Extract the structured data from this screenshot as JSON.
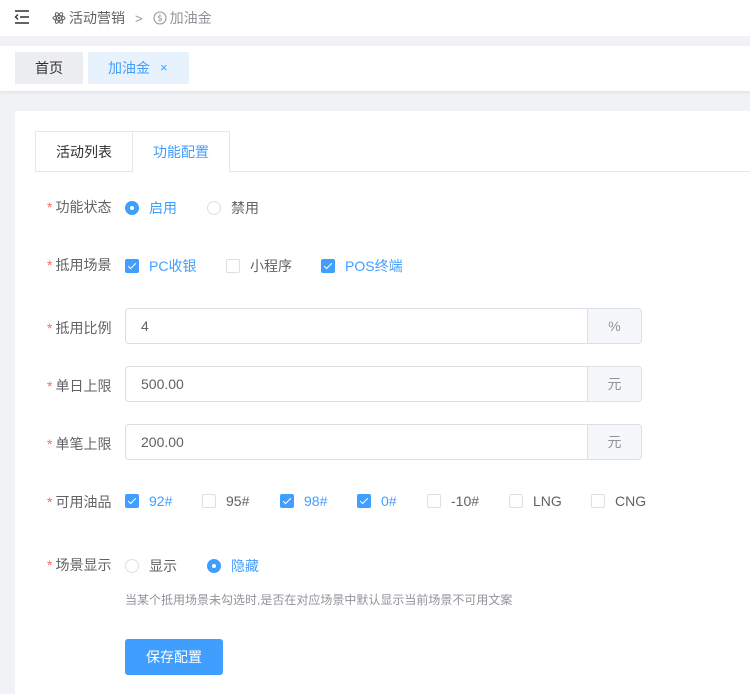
{
  "breadcrumb": {
    "items": [
      {
        "label": "活动营销",
        "icon": "atom-icon"
      },
      {
        "label": "加油金",
        "icon": "coin-icon"
      }
    ],
    "separator": ">"
  },
  "tags": {
    "home": "首页",
    "active": "加油金",
    "close": "×"
  },
  "tabs": [
    {
      "label": "活动列表",
      "active": false
    },
    {
      "label": "功能配置",
      "active": true
    }
  ],
  "form": {
    "status": {
      "label": "功能状态",
      "options": [
        {
          "label": "启用",
          "checked": true
        },
        {
          "label": "禁用",
          "checked": false
        }
      ]
    },
    "scene": {
      "label": "抵用场景",
      "options": [
        {
          "label": "PC收银",
          "checked": true
        },
        {
          "label": "小程序",
          "checked": false
        },
        {
          "label": "POS终端",
          "checked": true
        }
      ]
    },
    "ratio": {
      "label": "抵用比例",
      "value": "4",
      "unit": "%"
    },
    "daily_limit": {
      "label": "单日上限",
      "value": "500.00",
      "unit": "元"
    },
    "single_limit": {
      "label": "单笔上限",
      "value": "200.00",
      "unit": "元"
    },
    "fuel": {
      "label": "可用油品",
      "options": [
        {
          "label": "92#",
          "checked": true
        },
        {
          "label": "95#",
          "checked": false
        },
        {
          "label": "98#",
          "checked": true
        },
        {
          "label": "0#",
          "checked": true
        },
        {
          "label": "-10#",
          "checked": false
        },
        {
          "label": "LNG",
          "checked": false
        },
        {
          "label": "CNG",
          "checked": false
        }
      ]
    },
    "display": {
      "label": "场景显示",
      "options": [
        {
          "label": "显示",
          "checked": false
        },
        {
          "label": "隐藏",
          "checked": true
        }
      ],
      "hint": "当某个抵用场景未勾选时,是否在对应场景中默认显示当前场景不可用文案"
    },
    "required_mark": "*"
  },
  "save_button": "保存配置",
  "colors": {
    "primary": "#409eff",
    "required": "#f56c6c"
  }
}
